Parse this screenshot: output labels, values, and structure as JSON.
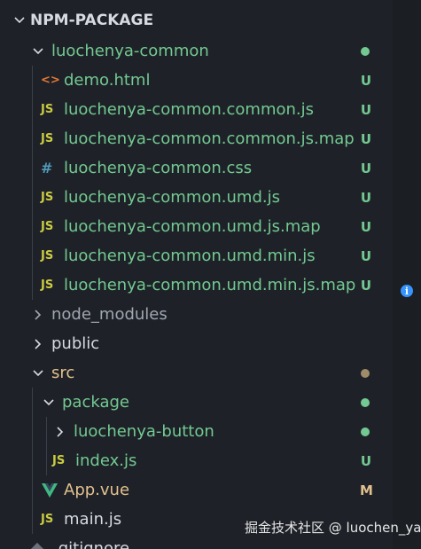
{
  "section": {
    "title": "NPM-PACKAGE"
  },
  "colors": {
    "green": "#73c991",
    "white": "#d7dae0",
    "gray": "#a0a6b0",
    "modified": "#e2c08d",
    "info": "#3794ff"
  },
  "tree": [
    {
      "name": "luochenya-common",
      "type": "folder",
      "expanded": true,
      "status": "dot",
      "icon": "chevron-down-icon"
    },
    {
      "name": "demo.html",
      "type": "file",
      "fileIcon": "<>",
      "status": "U"
    },
    {
      "name": "luochenya-common.common.js",
      "type": "file",
      "fileIcon": "JS",
      "status": "U"
    },
    {
      "name": "luochenya-common.common.js.map",
      "type": "file",
      "fileIcon": "JS",
      "status": "U"
    },
    {
      "name": "luochenya-common.css",
      "type": "file",
      "fileIcon": "#",
      "status": "U"
    },
    {
      "name": "luochenya-common.umd.js",
      "type": "file",
      "fileIcon": "JS",
      "status": "U"
    },
    {
      "name": "luochenya-common.umd.js.map",
      "type": "file",
      "fileIcon": "JS",
      "status": "U"
    },
    {
      "name": "luochenya-common.umd.min.js",
      "type": "file",
      "fileIcon": "JS",
      "status": "U"
    },
    {
      "name": "luochenya-common.umd.min.js.map",
      "type": "file",
      "fileIcon": "JS",
      "status": "U"
    },
    {
      "name": "node_modules",
      "type": "folder",
      "expanded": false
    },
    {
      "name": "public",
      "type": "folder",
      "expanded": false
    },
    {
      "name": "src",
      "type": "folder",
      "expanded": true,
      "status": "dot"
    },
    {
      "name": "package",
      "type": "folder",
      "expanded": true,
      "status": "dot"
    },
    {
      "name": "luochenya-button",
      "type": "folder",
      "expanded": false,
      "status": "dot"
    },
    {
      "name": "index.js",
      "type": "file",
      "fileIcon": "JS",
      "status": "U"
    },
    {
      "name": "App.vue",
      "type": "file",
      "fileIcon": "V",
      "status": "M"
    },
    {
      "name": "main.js",
      "type": "file",
      "fileIcon": "JS"
    },
    {
      "name": ".gitignore",
      "type": "file",
      "fileIcon": "git"
    }
  ],
  "notification": {
    "icon": "i"
  },
  "watermark": "掘金技术社区 @ luochen_ya"
}
